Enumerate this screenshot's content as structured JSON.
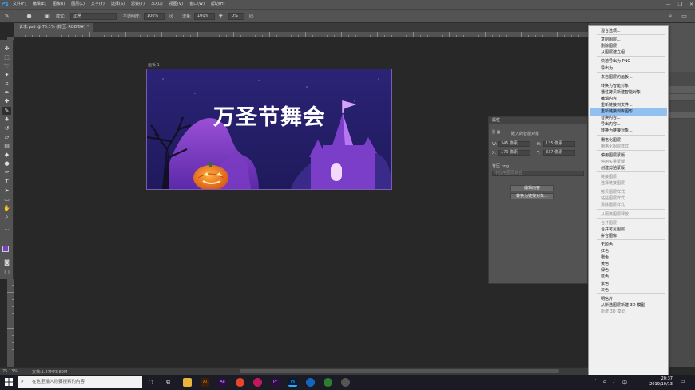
{
  "menubar": {
    "logo": "Ps",
    "items": [
      "文件(F)",
      "编辑(E)",
      "图像(I)",
      "图层(L)",
      "文字(Y)",
      "选择(S)",
      "滤镜(T)",
      "3D(D)",
      "视图(V)",
      "窗口(W)",
      "帮助(H)"
    ],
    "win_controls": [
      "—",
      "❐",
      "✕"
    ]
  },
  "options": {
    "mode_label": "模式:",
    "mode_value": "正常",
    "opacity_label": "不透明度:",
    "opacity_value": "100%",
    "flow_label": "流量:",
    "flow_value": "100%",
    "extra_value": "0%"
  },
  "document": {
    "tab_title": "诉求.psd @ 75.1% (背压, RGB/8#) *",
    "artboard_label": "画板 1",
    "banner_title": "万圣节舞会"
  },
  "properties": {
    "header": "属性",
    "layer_type": "嵌入的智能对象",
    "w_label": "W:",
    "w_value": "345 像素",
    "h_label": "H:",
    "h_value": "135 像素",
    "x_label": "X:",
    "x_value": "170 像素",
    "y_label": "Y:",
    "y_value": "337 像素",
    "file_label": "背压.png",
    "comp_placeholder": "不应用图层复合",
    "edit_button": "编辑内容",
    "convert_button": "转换为链接对象..."
  },
  "context_menu": {
    "items": [
      {
        "label": "混合选项...",
        "disabled": false
      },
      {
        "sep": true
      },
      {
        "label": "复制图层...",
        "disabled": false
      },
      {
        "label": "删除图层",
        "disabled": false
      },
      {
        "label": "从图层建立组...",
        "disabled": false
      },
      {
        "sep": true
      },
      {
        "label": "快速导出为 PNG",
        "disabled": false
      },
      {
        "label": "导出为...",
        "disabled": false
      },
      {
        "sep": true
      },
      {
        "label": "来自图层的画板...",
        "disabled": false
      },
      {
        "sep": true
      },
      {
        "label": "转换为智能对象",
        "disabled": false
      },
      {
        "label": "通过拷贝新建智能对象",
        "disabled": false
      },
      {
        "label": "编辑内容",
        "disabled": false
      },
      {
        "label": "重新链接到文件...",
        "disabled": false
      },
      {
        "label": "重新链接到库图形...",
        "disabled": false,
        "highlight": true
      },
      {
        "label": "替换内容...",
        "disabled": false
      },
      {
        "label": "导出内容...",
        "disabled": false
      },
      {
        "label": "转换为链接对象...",
        "disabled": false
      },
      {
        "sep": true
      },
      {
        "label": "栅格化图层",
        "disabled": false
      },
      {
        "label": "栅格化图层样式",
        "disabled": true
      },
      {
        "sep": true
      },
      {
        "label": "停用图层蒙版",
        "disabled": false
      },
      {
        "label": "停用矢量蒙版",
        "disabled": true
      },
      {
        "label": "创建剪贴蒙版",
        "disabled": false
      },
      {
        "sep": true
      },
      {
        "label": "链接图层",
        "disabled": true
      },
      {
        "label": "选择链接图层",
        "disabled": true
      },
      {
        "sep": true
      },
      {
        "label": "拷贝图层样式",
        "disabled": true
      },
      {
        "label": "粘贴图层样式",
        "disabled": true
      },
      {
        "label": "清除图层样式",
        "disabled": true
      },
      {
        "sep": true
      },
      {
        "label": "从隔离图层释放",
        "disabled": true
      },
      {
        "sep": true
      },
      {
        "label": "合并图层",
        "disabled": true
      },
      {
        "label": "合并可见图层",
        "disabled": false
      },
      {
        "label": "拼合图像",
        "disabled": false
      },
      {
        "sep": true
      },
      {
        "label": "无颜色",
        "disabled": false
      },
      {
        "label": "红色",
        "disabled": false
      },
      {
        "label": "橙色",
        "disabled": false
      },
      {
        "label": "黄色",
        "disabled": false
      },
      {
        "label": "绿色",
        "disabled": false
      },
      {
        "label": "蓝色",
        "disabled": false
      },
      {
        "label": "紫色",
        "disabled": false
      },
      {
        "label": "灰色",
        "disabled": false
      },
      {
        "sep": true
      },
      {
        "label": "明信片",
        "disabled": false
      },
      {
        "label": "从所选图层新建 3D 模型",
        "disabled": false
      },
      {
        "label": "新建 3D 模型",
        "disabled": true
      }
    ]
  },
  "status": {
    "zoom": "75.13%",
    "doc": "文档:1.27M/3.89M"
  },
  "taskbar": {
    "search_placeholder": "在这里输入你要搜索的内容",
    "time": "20:37",
    "date": "2019/10/13"
  },
  "colors": {
    "banner_bg": "#2a2170",
    "accent_purple": "#8a3fd1",
    "highlight": "#92c1f0",
    "ps_blue": "#31a8ff"
  }
}
